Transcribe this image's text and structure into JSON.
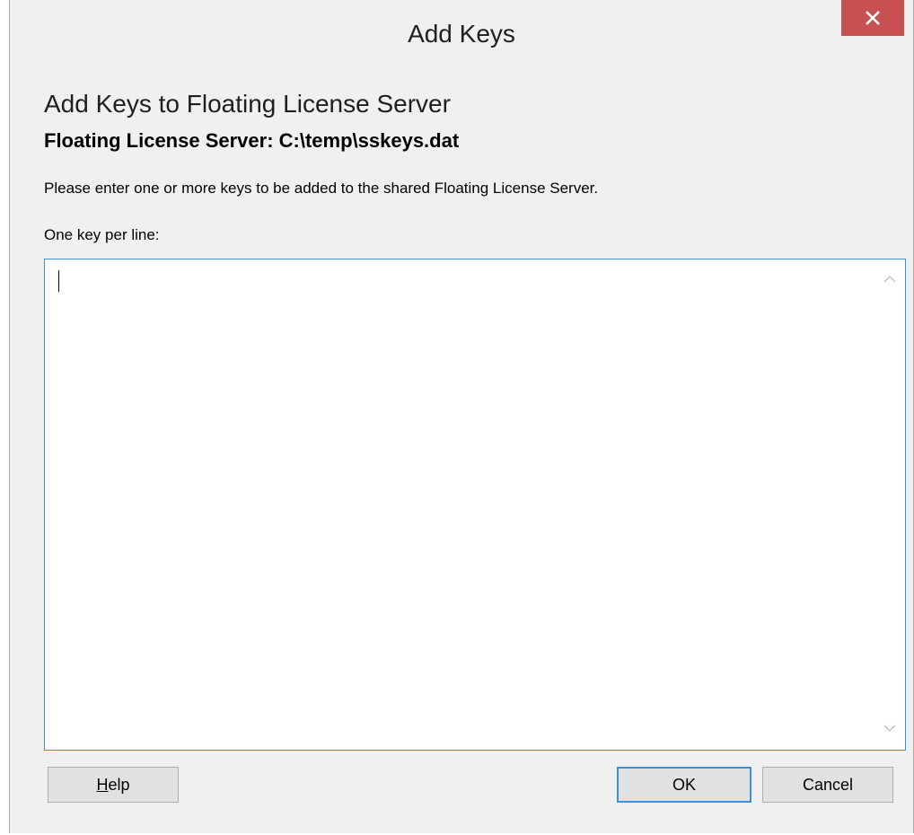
{
  "window": {
    "title": "Add Keys",
    "close_icon": "close-icon",
    "close_color": "#c75050"
  },
  "content": {
    "heading": "Add Keys to Floating License Server",
    "server_label": "Floating License Server: C:\\temp\\sskeys.dat",
    "description": "Please enter one or more keys to be added to the shared Floating License Server.",
    "input_label": "One key per line:",
    "keys_value": ""
  },
  "buttons": {
    "help_mnemonic": "H",
    "help_rest": "elp",
    "ok": "OK",
    "cancel": "Cancel"
  },
  "colors": {
    "focus_border": "#3c8fd8",
    "dialog_bg": "#f0f0f0"
  }
}
